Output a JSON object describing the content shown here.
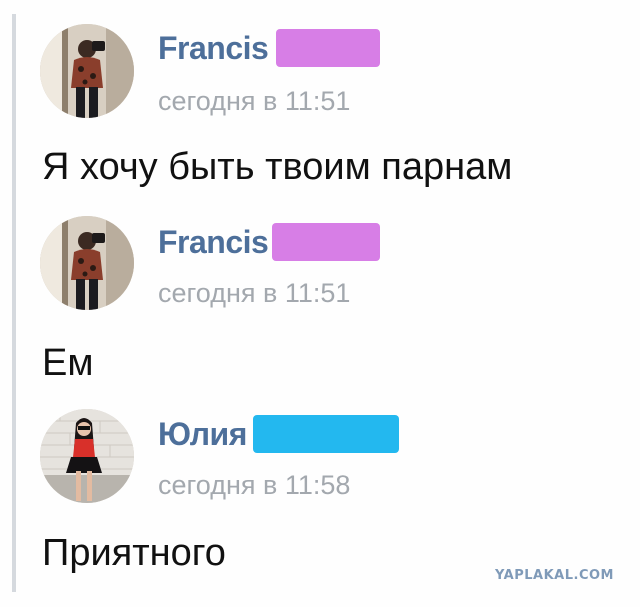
{
  "messages": [
    {
      "author": "Francis",
      "redaction_color": "#d77ee6",
      "time": "сегодня в 11:51",
      "text": "Я хочу быть твоим парнам"
    },
    {
      "author": "Francis",
      "redaction_color": "#d77ee6",
      "time": "сегодня в 11:51",
      "text": "Ем"
    },
    {
      "author": "Юлия",
      "redaction_color": "#23b8ef",
      "time": "сегодня в 11:58",
      "text": "Приятного"
    }
  ],
  "watermark": "YAPLAKAL.COM",
  "colors": {
    "author_name": "#4d6f9a",
    "timestamp": "#a3a8ae",
    "message_text": "#111111",
    "thread_line": "#d5d9de"
  },
  "icons": {
    "message_1_avatar": "avatar-photo-mirror-selfie",
    "message_2_avatar": "avatar-photo-mirror-selfie",
    "message_3_avatar": "avatar-photo-girl-red-top"
  }
}
